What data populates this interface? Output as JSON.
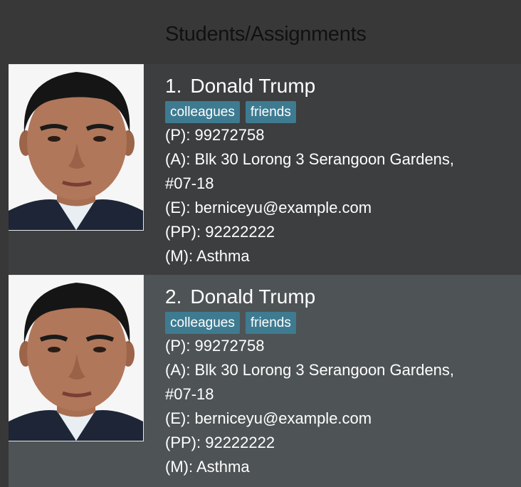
{
  "header": {
    "title": "Students/Assignments"
  },
  "students": [
    {
      "index": "1.",
      "name": "Donald Trump",
      "tags": [
        "colleagues",
        "friends"
      ],
      "phone": "(P): 99272758",
      "address_line1": "(A): Blk 30 Lorong 3 Serangoon Gardens,",
      "address_line2": "#07-18",
      "email": "(E): berniceyu@example.com",
      "parent_phone": "(PP): 92222222",
      "medical": "(M): Asthma"
    },
    {
      "index": "2.",
      "name": "Donald Trump",
      "tags": [
        "colleagues",
        "friends"
      ],
      "phone": "(P): 99272758",
      "address_line1": "(A): Blk 30 Lorong 3 Serangoon Gardens,",
      "address_line2": "#07-18",
      "email": "(E): berniceyu@example.com",
      "parent_phone": "(PP): 92222222",
      "medical": "(M): Asthma"
    }
  ],
  "colors": {
    "background": "#383838",
    "card_odd": "#3c3e3f",
    "card_even": "#4e5355",
    "tag": "#3e7b91"
  }
}
